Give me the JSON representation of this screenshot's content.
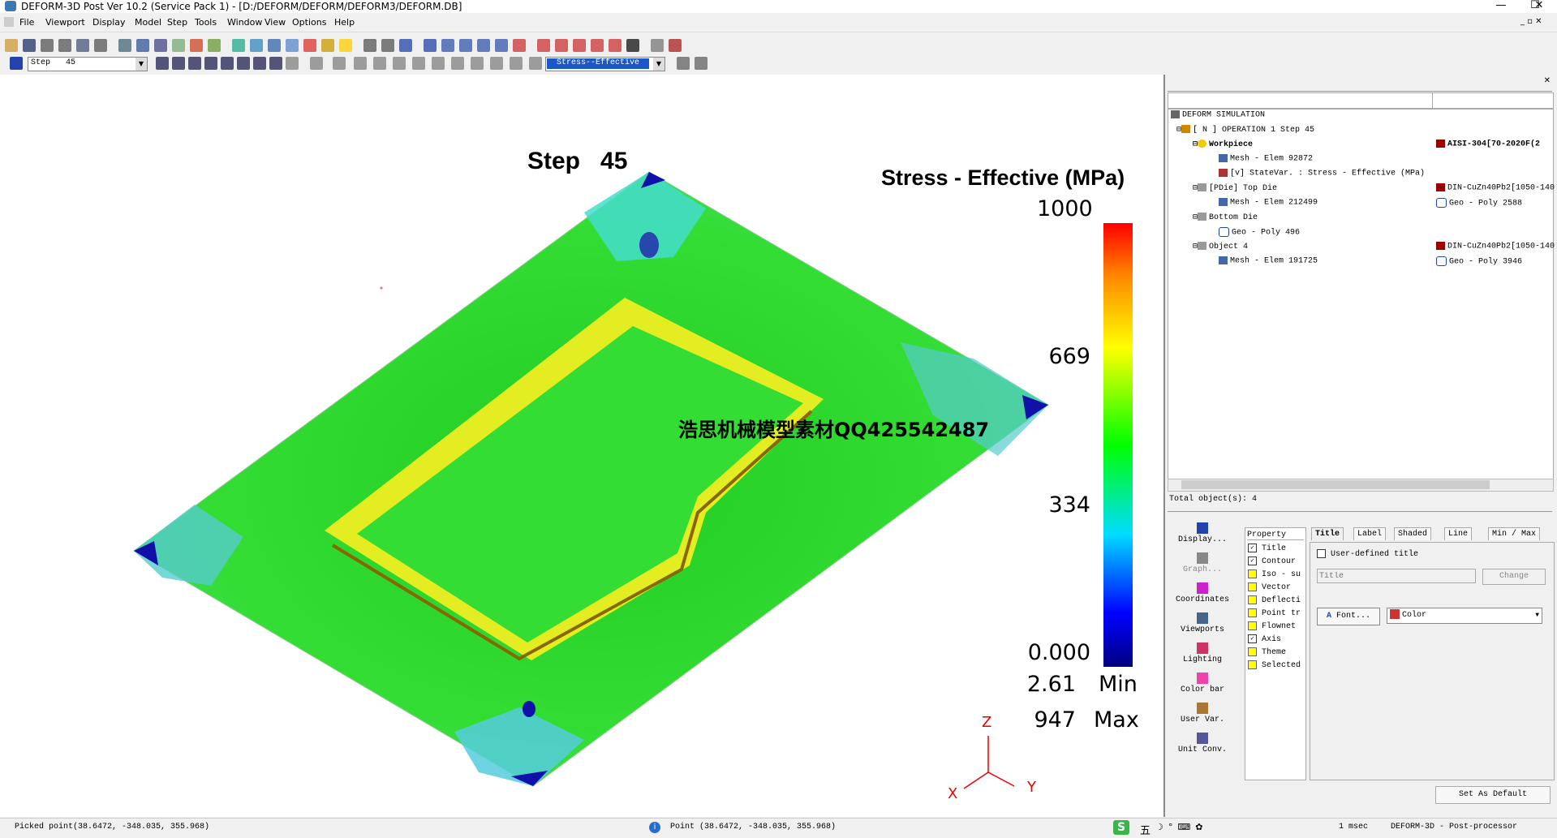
{
  "window": {
    "title": "DEFORM-3D Post Ver 10.2 (Service Pack 1)  - [D:/DEFORM/DEFORM/DEFORM3/DEFORM.DB]",
    "minimize": "—",
    "maximize": "☐",
    "close": "✕"
  },
  "menu": [
    "File",
    "Viewport",
    "Display",
    "Model",
    "Step",
    "Tools",
    "Window",
    "View",
    "Options",
    "Help"
  ],
  "toolbar2": {
    "step_label": "Step",
    "step_value": "45",
    "variable_value": "Stress--Effective"
  },
  "viewport": {
    "step_title": "Step   45",
    "colorbar_title": "Stress - Effective (MPa)",
    "colorbar_ticks": [
      "1000",
      "669",
      "334",
      "0.000"
    ],
    "min_value": "2.61",
    "min_label": "Min",
    "max_value": "947",
    "max_label": "Max",
    "watermark": "浩思机械模型素材QQ425542487",
    "axis_z": "Z",
    "axis_x": "X",
    "axis_y": "Y",
    "colors": {
      "max": "#ff2200",
      "high": "#ffee00",
      "mid": "#22dd22",
      "low": "#22dddd",
      "min": "#0000aa"
    }
  },
  "tree": {
    "root": "DEFORM SIMULATION",
    "operation": "[ N ]  OPERATION 1  Step 45",
    "workpiece": "Workpiece",
    "workpiece_material": "AISI-304[70-2020F(2",
    "workpiece_mesh": "Mesh - Elem 92872",
    "workpiece_statevar": "[v] StateVar. :  Stress - Effective (MPa)",
    "topdie": "[PDie] Top Die",
    "topdie_material": "DIN-CuZn40Pb2[1050-140",
    "topdie_mesh": "Mesh - Elem 212499",
    "topdie_geo": "Geo - Poly 2588",
    "bottomdie": "Bottom Die",
    "bottomdie_geo": "Geo - Poly 496",
    "object4": "Object 4",
    "object4_material": "DIN-CuZn40Pb2[1050-140",
    "object4_mesh": "Mesh - Elem 191725",
    "object4_geo": "Geo - Poly 3946",
    "total_objects": "Total object(s): 4"
  },
  "nav": [
    "Display...",
    "Graph...",
    "Coordinates",
    "Viewports",
    "Lighting",
    "Color bar",
    "User Var.",
    "Unit Conv."
  ],
  "properties": {
    "header": "Property",
    "items": [
      {
        "label": "Title",
        "checked": true
      },
      {
        "label": "Contour",
        "checked": true
      },
      {
        "label": "Iso - su",
        "checked": false
      },
      {
        "label": "Vector",
        "checked": false
      },
      {
        "label": "Deflecti",
        "checked": false
      },
      {
        "label": "Point tr",
        "checked": false
      },
      {
        "label": "Flownet",
        "checked": false
      },
      {
        "label": "Axis",
        "checked": true
      },
      {
        "label": "Theme",
        "checked": false
      },
      {
        "label": "Selected",
        "checked": false
      }
    ]
  },
  "tabs": [
    "Title",
    "Label",
    "Shaded",
    "Line",
    "Min / Max"
  ],
  "title_tab": {
    "user_defined": "User-defined title",
    "title_placeholder": "Title",
    "change_btn": "Change",
    "font_btn": "Font...",
    "color_select": "Color",
    "set_default": "Set As Default"
  },
  "status": {
    "picked": "Picked point(38.6472, -348.035, 355.968)",
    "point": "Point  (38.6472,  -348.035,  355.968)",
    "ime": "五",
    "time": "1 msec",
    "mode": "DEFORM-3D  -  Post-processor"
  }
}
